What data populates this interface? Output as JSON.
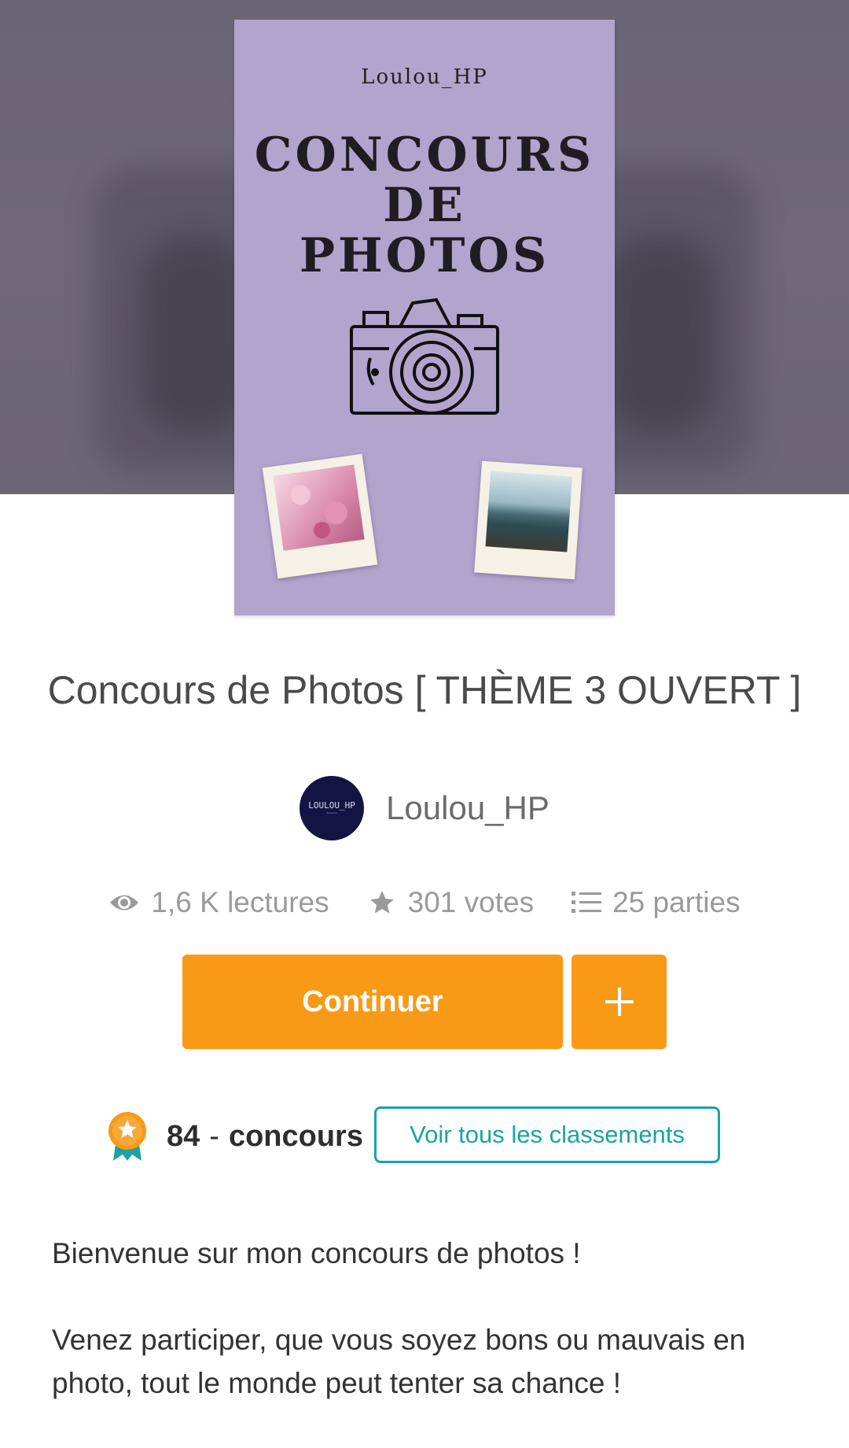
{
  "cover": {
    "author": "Loulou_HP",
    "title_lines": [
      "CONCOURS",
      "DE",
      "PHOTOS"
    ]
  },
  "story": {
    "title": "Concours de Photos [ THÈME 3 OUVERT ]",
    "author": "Loulou_HP",
    "avatar_text": "LOULOU_HP"
  },
  "stats": {
    "reads": "1,6 K lectures",
    "votes": "301 votes",
    "parts": "25 parties"
  },
  "actions": {
    "continue_label": "Continuer",
    "add_label": "+"
  },
  "ranking": {
    "rank": "84",
    "separator": "-",
    "category": "concours",
    "view_all_label": "Voir tous les classements"
  },
  "description": {
    "paragraph1": "Bienvenue sur mon concours de photos !",
    "paragraph2": "Venez participer, que vous soyez bons ou mauvais en photo, tout le monde peut tenter sa chance !"
  },
  "colors": {
    "accent": "#f99a16",
    "teal": "#1ba3a3",
    "cover_bg": "#b1a4cd",
    "hero_bg": "#6b6676"
  },
  "icons": {
    "reads": "eye-icon",
    "votes": "star-icon",
    "parts": "list-icon",
    "rank": "award-medal-icon",
    "add": "plus-icon",
    "camera": "camera-icon"
  }
}
